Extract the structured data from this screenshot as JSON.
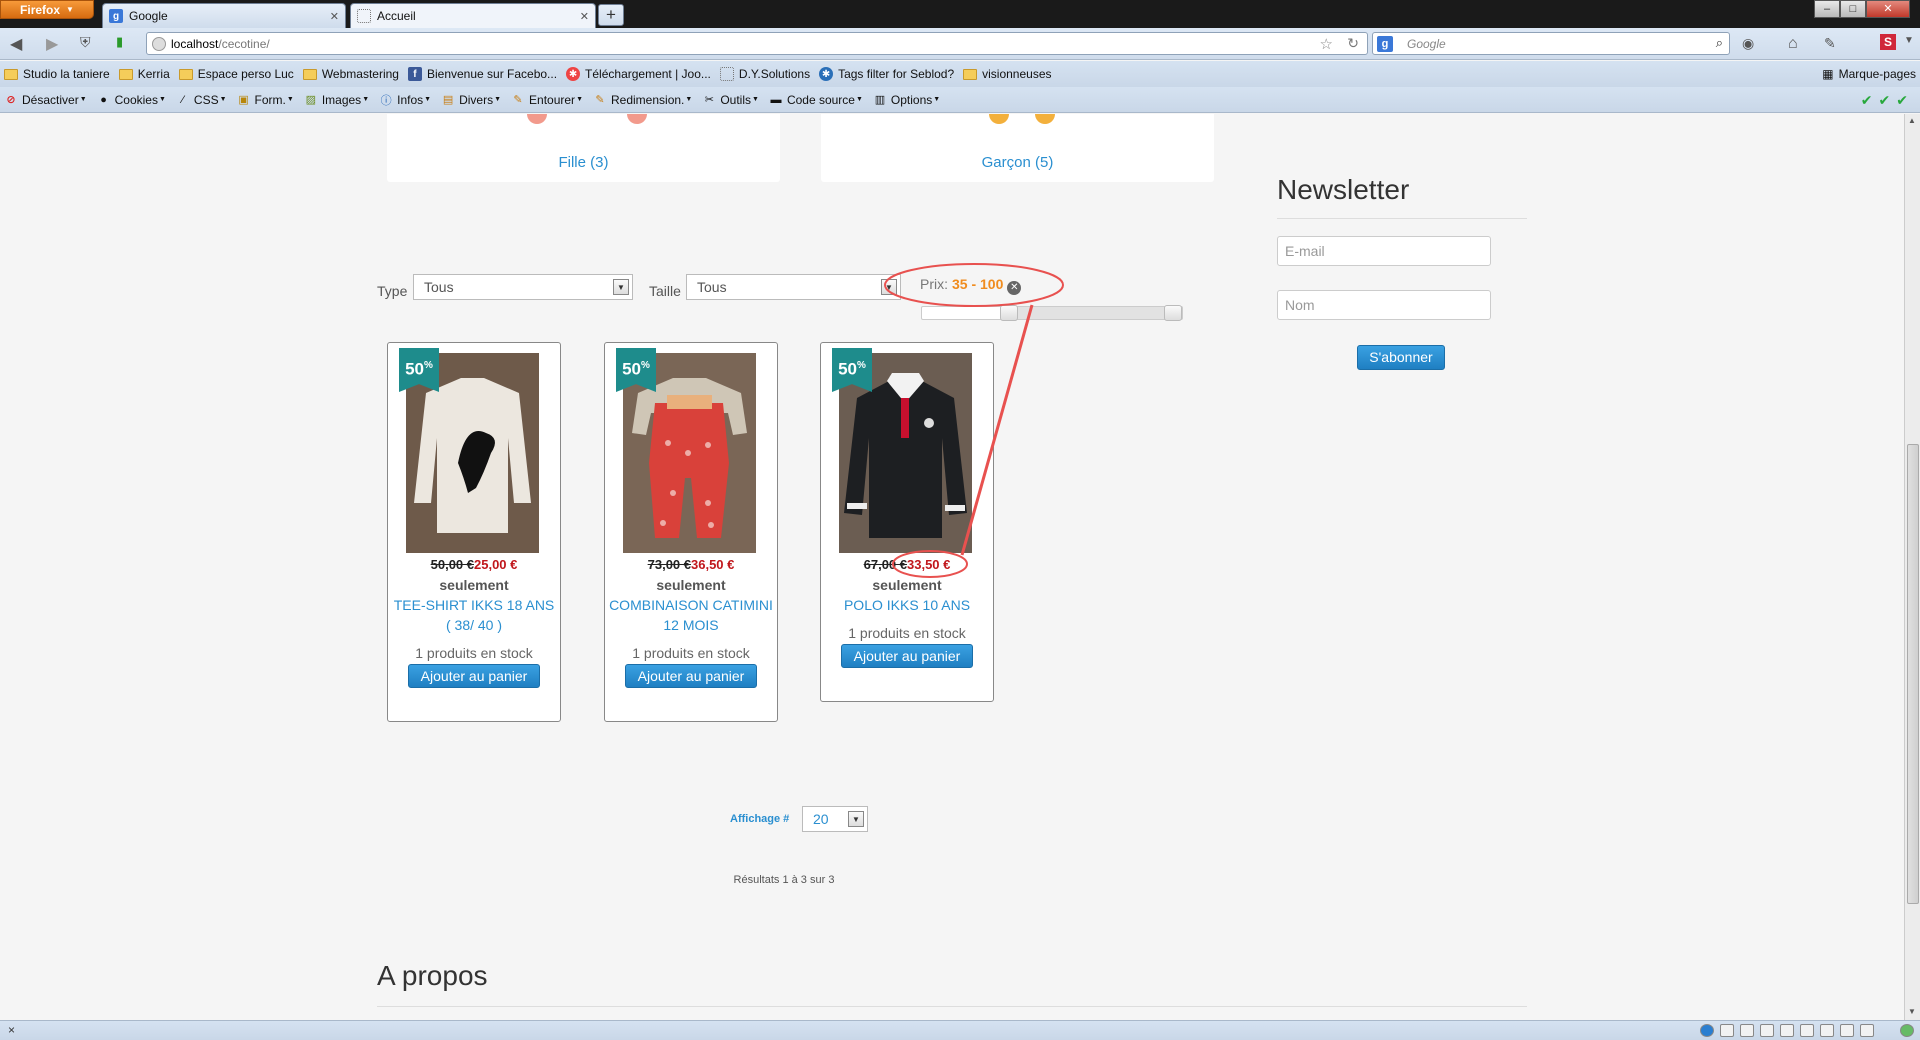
{
  "browser": {
    "app_button": "Firefox",
    "tabs": [
      {
        "label": "Google",
        "active": false
      },
      {
        "label": "Accueil",
        "active": true
      }
    ],
    "url_host": "localhost",
    "url_path": "/cecotine/",
    "search_placeholder": "Google",
    "bookmarks": [
      "Studio la taniere",
      "Kerria",
      "Espace perso Luc",
      "Webmastering",
      "Bienvenue sur Facebo...",
      "Téléchargement | Joo...",
      "D.Y.Solutions",
      "Tags filter for Seblod?",
      "visionneuses"
    ],
    "bookmarks_right": "Marque-pages",
    "devtools": [
      "Désactiver",
      "Cookies",
      "CSS",
      "Form.",
      "Images",
      "Infos",
      "Divers",
      "Entourer",
      "Redimension.",
      "Outils",
      "Code source",
      "Options"
    ],
    "status_close": "×"
  },
  "categories": [
    {
      "label": "Fille (3)"
    },
    {
      "label": "Garçon (5)"
    }
  ],
  "newsletter": {
    "title": "Newsletter",
    "email_placeholder": "E-mail",
    "name_placeholder": "Nom",
    "subscribe_label": "S'abonner"
  },
  "filters": {
    "type_label": "Type",
    "type_value": "Tous",
    "size_label": "Taille",
    "size_value": "Tous",
    "price_label": "Prix:",
    "price_range": "35 - 100",
    "price_min": 35,
    "price_max": 100
  },
  "products": [
    {
      "badge": "50",
      "old_price": "50,00 €",
      "new_price": "25,00 €",
      "only": "seulement",
      "name": "TEE-SHIRT IKKS 18 ANS ( 38/ 40 )",
      "stock": "1 produits en stock",
      "add_label": "Ajouter au panier"
    },
    {
      "badge": "50",
      "old_price": "73,00 €",
      "new_price": "36,50 €",
      "only": "seulement",
      "name": "COMBINAISON CATIMINI 12 MOIS",
      "stock": "1 produits en stock",
      "add_label": "Ajouter au panier"
    },
    {
      "badge": "50",
      "old_price": "67,00 €",
      "new_price": "33,50 €",
      "only": "seulement",
      "name": "POLO IKKS 10 ANS",
      "stock": "1 produits en stock",
      "add_label": "Ajouter au panier"
    }
  ],
  "pagination": {
    "display_label": "Affichage #",
    "display_value": "20",
    "results": "Résultats 1 à 3 sur 3"
  },
  "about": {
    "title": "A propos"
  },
  "colors": {
    "link": "#2a8fd0",
    "price_new": "#c0161b",
    "range": "#f08c1e",
    "badge": "#1e8c8c",
    "annotation": "#e8514f"
  }
}
